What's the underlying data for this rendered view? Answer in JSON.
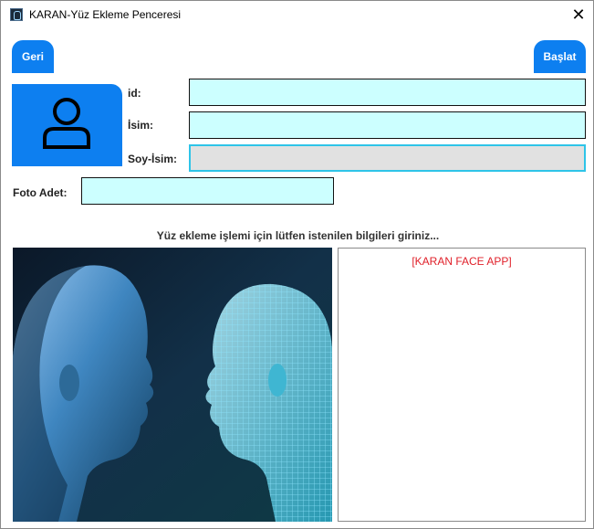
{
  "window": {
    "title": "KARAN-Yüz Ekleme Penceresi",
    "close_glyph": "✕"
  },
  "buttons": {
    "back_label": "Geri",
    "start_label": "Başlat"
  },
  "avatar": {
    "icon": "user-icon"
  },
  "form": {
    "id_label": "id:",
    "id_value": "",
    "name_label": "İsim:",
    "name_value": "",
    "surname_label": "Soy-İsim:",
    "surname_value": "",
    "photo_count_label": "Foto Adet:",
    "photo_count_value": ""
  },
  "instruction": "Yüz ekleme işlemi için lütfen istenilen bilgileri giriniz...",
  "output_panel": {
    "title": "[KARAN FACE APP]"
  },
  "colors": {
    "accent": "#0d7ff0",
    "field_bg": "#ccffff",
    "focused_field_bg": "#e1e1e1",
    "focus_border": "#2ec4e8",
    "panel_title": "#e0202a"
  }
}
